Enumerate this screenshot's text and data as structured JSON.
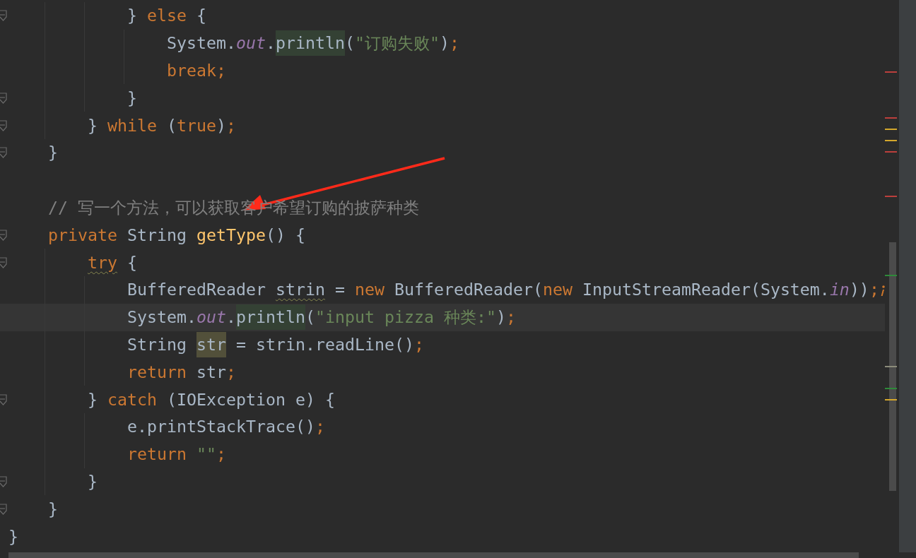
{
  "editor": {
    "lines": [
      {
        "fold_marker": true,
        "tokens": [
          {
            "kind": "plain",
            "text": "            } "
          },
          {
            "kind": "keyword",
            "text": "else"
          },
          {
            "kind": "plain",
            "text": " {"
          }
        ]
      },
      {
        "fold_marker": false,
        "tokens": [
          {
            "kind": "plain",
            "text": "                System."
          },
          {
            "kind": "field",
            "text": "out"
          },
          {
            "kind": "plain",
            "text": "."
          },
          {
            "kind": "plain",
            "text": "println",
            "match_highlight": true
          },
          {
            "kind": "plain",
            "text": "("
          },
          {
            "kind": "string",
            "text": "\"订购失败\""
          },
          {
            "kind": "plain",
            "text": ")"
          },
          {
            "kind": "keyword",
            "text": ";"
          }
        ]
      },
      {
        "fold_marker": false,
        "tokens": [
          {
            "kind": "keyword",
            "text": "                break;"
          }
        ]
      },
      {
        "fold_marker": true,
        "tokens": [
          {
            "kind": "plain",
            "text": "            }"
          }
        ]
      },
      {
        "fold_marker": true,
        "tokens": [
          {
            "kind": "plain",
            "text": "        } "
          },
          {
            "kind": "keyword",
            "text": "while"
          },
          {
            "kind": "plain",
            "text": " ("
          },
          {
            "kind": "keyword",
            "text": "true"
          },
          {
            "kind": "plain",
            "text": ")"
          },
          {
            "kind": "keyword",
            "text": ";"
          }
        ]
      },
      {
        "fold_marker": true,
        "tokens": [
          {
            "kind": "plain",
            "text": "    }"
          }
        ]
      },
      {
        "fold_marker": false
      },
      {
        "fold_marker": false,
        "tokens": [
          {
            "kind": "comment",
            "text": "    // 写一个方法，可以获取客户希望订购的披萨种类"
          }
        ]
      },
      {
        "fold_marker": true,
        "tokens": [
          {
            "kind": "keyword",
            "text": "    private"
          },
          {
            "kind": "plain",
            "text": " String "
          },
          {
            "kind": "method",
            "text": "getType"
          },
          {
            "kind": "plain",
            "text": "() {"
          }
        ]
      },
      {
        "fold_marker": true,
        "tokens": [
          {
            "kind": "keyword",
            "text": "        try",
            "warning": true
          },
          {
            "kind": "plain",
            "text": " {"
          }
        ]
      },
      {
        "fold_marker": false,
        "tokens": [
          {
            "kind": "plain",
            "text": "            BufferedReader "
          },
          {
            "kind": "plain",
            "text": "strin",
            "warning": true
          },
          {
            "kind": "plain",
            "text": " = "
          },
          {
            "kind": "keyword",
            "text": "new"
          },
          {
            "kind": "plain",
            "text": " BufferedReader("
          },
          {
            "kind": "keyword",
            "text": "new"
          },
          {
            "kind": "plain",
            "text": " InputStreamReader(System."
          },
          {
            "kind": "field",
            "text": "in"
          },
          {
            "kind": "plain",
            "text": "))"
          },
          {
            "kind": "keyword",
            "text": ";"
          }
        ]
      },
      {
        "fold_marker": false,
        "current": true,
        "tokens": [
          {
            "kind": "plain",
            "text": "            System."
          },
          {
            "kind": "field",
            "text": "out"
          },
          {
            "kind": "plain",
            "text": "."
          },
          {
            "kind": "plain",
            "text": "println",
            "match_highlight": true
          },
          {
            "kind": "plain",
            "text": "("
          },
          {
            "kind": "string",
            "text": "\"input pizza 种类:\""
          },
          {
            "kind": "plain",
            "text": ")"
          },
          {
            "kind": "keyword",
            "text": ";"
          }
        ]
      },
      {
        "fold_marker": false,
        "tokens": [
          {
            "kind": "plain",
            "text": "            String "
          },
          {
            "kind": "plain",
            "text": "str",
            "usage_highlight": true
          },
          {
            "kind": "plain",
            "text": " = strin.readLine()"
          },
          {
            "kind": "keyword",
            "text": ";"
          }
        ]
      },
      {
        "fold_marker": false,
        "tokens": [
          {
            "kind": "keyword",
            "text": "            return"
          },
          {
            "kind": "plain",
            "text": " str"
          },
          {
            "kind": "keyword",
            "text": ";"
          }
        ]
      },
      {
        "fold_marker": true,
        "tokens": [
          {
            "kind": "plain",
            "text": "        } "
          },
          {
            "kind": "keyword",
            "text": "catch"
          },
          {
            "kind": "plain",
            "text": " (IOException e) {"
          }
        ]
      },
      {
        "fold_marker": false,
        "tokens": [
          {
            "kind": "plain",
            "text": "            e.printStackTrace()"
          },
          {
            "kind": "keyword",
            "text": ";"
          }
        ]
      },
      {
        "fold_marker": false,
        "tokens": [
          {
            "kind": "keyword",
            "text": "            return"
          },
          {
            "kind": "string",
            "text": " \"\""
          },
          {
            "kind": "keyword",
            "text": ";"
          }
        ]
      },
      {
        "fold_marker": true,
        "tokens": [
          {
            "kind": "plain",
            "text": "        }"
          }
        ]
      },
      {
        "fold_marker": true,
        "tokens": [
          {
            "kind": "plain",
            "text": "    }"
          }
        ]
      },
      {
        "fold_marker": false,
        "tokens": [
          {
            "kind": "plain",
            "text": "}"
          }
        ]
      }
    ],
    "error_stripe": [
      {
        "color": "#bc3f3c"
      },
      {
        "color": "#bc3f3c"
      },
      {
        "color": "#d4a72c"
      },
      {
        "color": "#d4a72c"
      },
      {
        "color": "#bc3f3c"
      },
      {
        "color": "#bc3f3c"
      },
      {
        "color": "#2f8a3a"
      },
      {
        "color": "#8c8c7a"
      },
      {
        "color": "#2f8a3a"
      },
      {
        "color": "#d4a72c"
      }
    ]
  }
}
